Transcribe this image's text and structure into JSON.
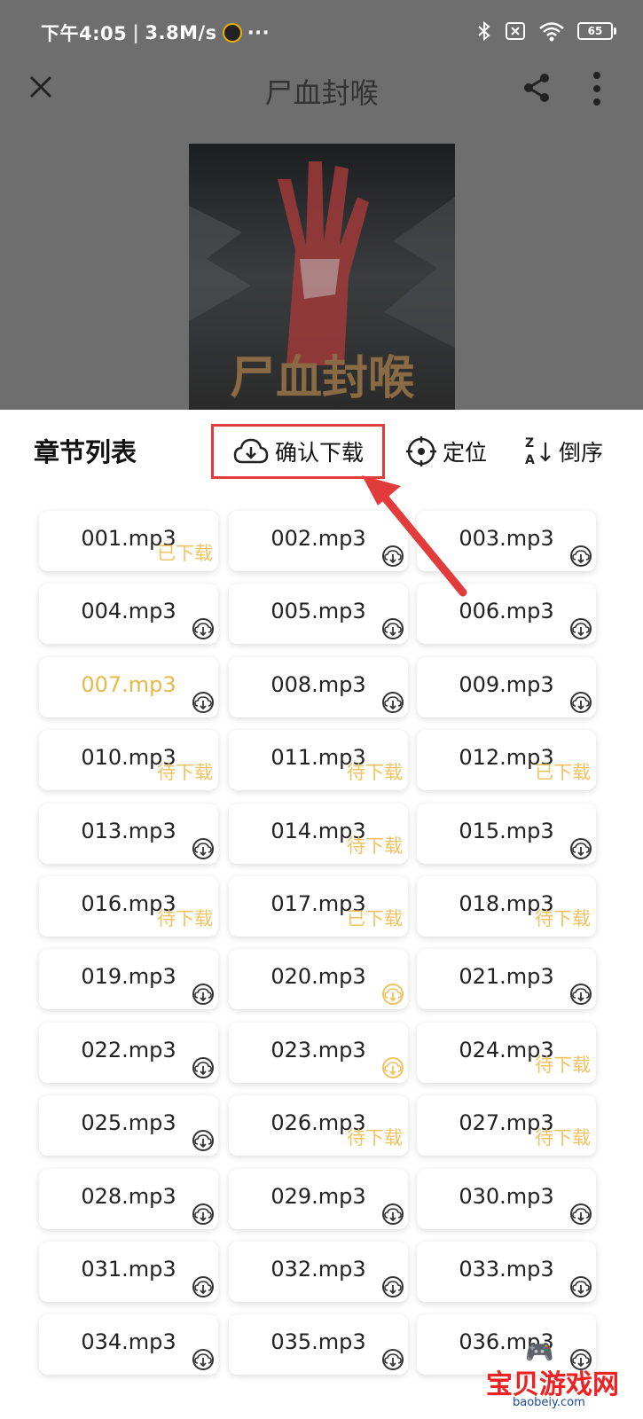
{
  "status_bar": {
    "time": "下午4:05",
    "speed": "3.8M/s",
    "more": "···",
    "battery": "65"
  },
  "header": {
    "title": "尸血封喉"
  },
  "cover": {
    "text": "尸血封喉"
  },
  "chapter_list": {
    "title": "章节列表",
    "confirm_download": "确认下载",
    "locate": "定位",
    "reverse": "倒序"
  },
  "tracks": [
    {
      "name": "001.mp3",
      "status": "已下载"
    },
    {
      "name": "002.mp3",
      "status": "download"
    },
    {
      "name": "003.mp3",
      "status": "download"
    },
    {
      "name": "004.mp3",
      "status": "download"
    },
    {
      "name": "005.mp3",
      "status": "download"
    },
    {
      "name": "006.mp3",
      "status": "download"
    },
    {
      "name": "007.mp3",
      "status": "download",
      "playing": true
    },
    {
      "name": "008.mp3",
      "status": "download"
    },
    {
      "name": "009.mp3",
      "status": "download"
    },
    {
      "name": "010.mp3",
      "status": "待下载"
    },
    {
      "name": "011.mp3",
      "status": "待下载"
    },
    {
      "name": "012.mp3",
      "status": "已下载"
    },
    {
      "name": "013.mp3",
      "status": "download"
    },
    {
      "name": "014.mp3",
      "status": "待下载"
    },
    {
      "name": "015.mp3",
      "status": "download"
    },
    {
      "name": "016.mp3",
      "status": "待下载"
    },
    {
      "name": "017.mp3",
      "status": "已下载"
    },
    {
      "name": "018.mp3",
      "status": "待下载"
    },
    {
      "name": "019.mp3",
      "status": "download"
    },
    {
      "name": "020.mp3",
      "status": "downloading"
    },
    {
      "name": "021.mp3",
      "status": "download"
    },
    {
      "name": "022.mp3",
      "status": "download"
    },
    {
      "name": "023.mp3",
      "status": "downloading"
    },
    {
      "name": "024.mp3",
      "status": "待下载"
    },
    {
      "name": "025.mp3",
      "status": "download"
    },
    {
      "name": "026.mp3",
      "status": "待下载"
    },
    {
      "name": "027.mp3",
      "status": "待下载"
    },
    {
      "name": "028.mp3",
      "status": "download"
    },
    {
      "name": "029.mp3",
      "status": "download"
    },
    {
      "name": "030.mp3",
      "status": "download"
    },
    {
      "name": "031.mp3",
      "status": "download"
    },
    {
      "name": "032.mp3",
      "status": "download"
    },
    {
      "name": "033.mp3",
      "status": "download"
    },
    {
      "name": "034.mp3",
      "status": "download"
    },
    {
      "name": "035.mp3",
      "status": "download"
    },
    {
      "name": "036.mp3",
      "status": "download"
    }
  ],
  "watermark": {
    "cn": "宝贝游戏网",
    "en": "baobeiy.com"
  },
  "colors": {
    "accent": "#f0c360",
    "highlight_box": "#e23b3b",
    "arrow": "#e23b3b",
    "overlay": "#6e6e6e"
  }
}
